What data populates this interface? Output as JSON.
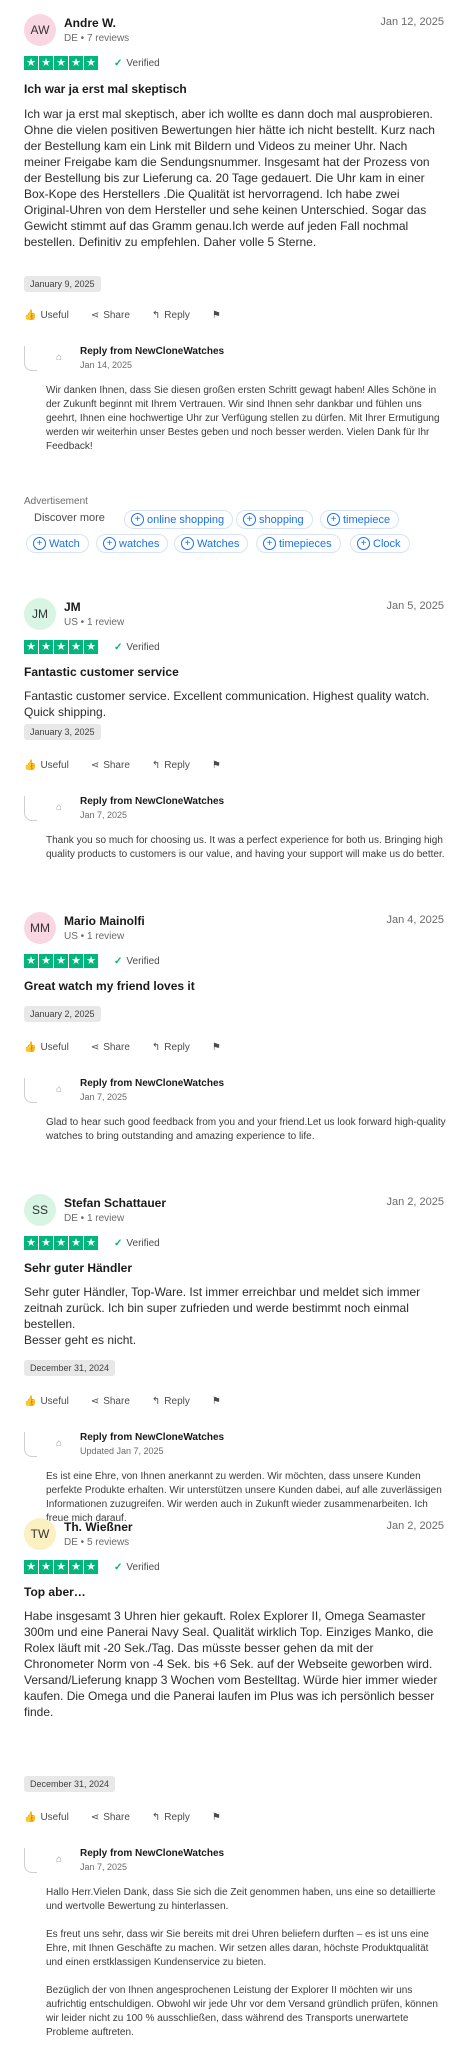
{
  "reviews": [
    {
      "initials": "AW",
      "avatar_color": "#f9d7e2",
      "name": "Andre W.",
      "meta": "DE • 7 reviews",
      "date": "Jan 12, 2025",
      "verified": "Verified",
      "title": "Ich war ja erst mal skeptisch",
      "body": "Ich war ja erst mal skeptisch, aber ich wollte es dann doch mal ausprobieren. Ohne die vielen positiven Bewertungen hier hätte ich nicht bestellt. Kurz nach der Bestellung kam ein Link mit Bildern und Videos zu meiner Uhr. Nach meiner Freigabe kam die Sendungsnummer. Insgesamt hat der Prozess von der Bestellung bis zur Lieferung ca. 20 Tage gedauert. Die Uhr kam in einer Box-Kope des Herstellers .Die Qualität ist hervorragend. Ich habe zwei Original-Uhren von dem Hersteller und sehe keinen Unterschied. Sogar das Gewicht stimmt auf das Gramm genau.Ich werde auf jeden Fall nochmal bestellen. Definitiv zu empfehlen. Daher volle 5 Sterne.",
      "experience_date": "January 9, 2025",
      "reply": {
        "from": "Reply from NewCloneWatches",
        "date": "Jan 14, 2025",
        "text": "Wir danken Ihnen, dass Sie diesen großen ersten Schritt gewagt haben! Alles Schöne in der Zukunft beginnt mit Ihrem Vertrauen. Wir sind Ihnen sehr dankbar und fühlen uns geehrt, Ihnen eine hochwertige Uhr zur Verfügung stellen zu dürfen. Mit Ihrer Ermutigung werden wir weiterhin unser Bestes geben und noch besser werden. Vielen Dank für Ihr Feedback!"
      }
    },
    {
      "initials": "JM",
      "avatar_color": "#d8f5e3",
      "name": "JM",
      "meta": "US • 1 review",
      "date": "Jan 5, 2025",
      "verified": "Verified",
      "title": "Fantastic customer service",
      "body": "Fantastic customer service. Excellent communication. Highest quality watch. Quick shipping.",
      "experience_date": "January 3, 2025",
      "reply": {
        "from": "Reply from NewCloneWatches",
        "date": "Jan 7, 2025",
        "text": "Thank you so much for choosing us. It was a perfect experience for both us. Bringing high quality products to customers is our value, and having your support will make us do better."
      }
    },
    {
      "initials": "MM",
      "avatar_color": "#f9d7e2",
      "name": "Mario Mainolfi",
      "meta": "US • 1 review",
      "date": "Jan 4, 2025",
      "verified": "Verified",
      "title": "Great watch my friend loves it",
      "body": "",
      "experience_date": "January 2, 2025",
      "reply": {
        "from": "Reply from NewCloneWatches",
        "date": "Jan 7, 2025",
        "text": "Glad to hear such good feedback from you and your friend.Let us look forward high-quality watches to bring outstanding and amazing experience to life."
      }
    },
    {
      "initials": "SS",
      "avatar_color": "#d8f5e3",
      "name": "Stefan Schattauer",
      "meta": "DE • 1 review",
      "date": "Jan 2, 2025",
      "verified": "Verified",
      "title": "Sehr guter Händler",
      "body": "Sehr guter Händler, Top-Ware. Ist immer erreichbar und meldet sich immer zeitnah zurück. Ich bin super zufrieden und werde bestimmt noch einmal bestellen.\nBesser geht es nicht.",
      "experience_date": "December 31, 2024",
      "reply": {
        "from": "Reply from NewCloneWatches",
        "date": "Updated Jan 7, 2025",
        "text": "Es ist eine Ehre, von Ihnen anerkannt zu werden. Wir möchten, dass unsere Kunden perfekte Produkte erhalten. Wir unterstützen unsere Kunden dabei, auf alle zuverlässigen Informationen zuzugreifen. Wir werden auch in Zukunft wieder zusammenarbeiten. Ich freue mich darauf."
      }
    },
    {
      "initials": "TW",
      "avatar_color": "#fbf0c2",
      "name": "Th. Wießner",
      "meta": "DE • 5 reviews",
      "date": "Jan 2, 2025",
      "verified": "Verified",
      "title": "Top aber…",
      "body": "Habe insgesamt 3 Uhren hier gekauft. Rolex Explorer II, Omega Seamaster 300m und eine Panerai Navy Seal. Qualität wirklich Top. Einziges Manko, die Rolex läuft mit -20 Sek./Tag. Das müsste besser gehen da mit der Chronometer Norm von -4 Sek. bis +6 Sek. auf der Webseite geworben wird. Versand/Lieferung knapp 3 Wochen vom Bestelltag. Würde hier immer wieder kaufen. Die Omega und die Panerai laufen im Plus was ich persönlich besser finde.",
      "experience_date": "December 31, 2024",
      "reply": {
        "from": "Reply from NewCloneWatches",
        "date": "Jan 7, 2025",
        "text": "Hallo Herr.Vielen Dank, dass Sie sich die Zeit genommen haben, uns eine so detaillierte und wertvolle Bewertung zu hinterlassen.\n\nEs freut uns sehr, dass wir Sie bereits mit drei Uhren beliefern durften – es ist uns eine Ehre, mit Ihnen Geschäfte zu machen. Wir setzen alles daran, höchste Produktqualität und einen erstklassigen Kundenservice zu bieten.\n\nBezüglich der von Ihnen angesprochenen Leistung der Explorer II möchten wir uns aufrichtig entschuldigen. Obwohl wir jede Uhr vor dem Versand gründlich prüfen, können wir leider nicht zu 100 % ausschließen, dass während des Transports unerwartete Probleme auftreten."
      }
    }
  ],
  "actions": {
    "useful": "Useful",
    "share": "Share",
    "reply": "Reply"
  },
  "ad": {
    "label": "Advertisement",
    "discover": "Discover more",
    "chips": [
      "online shopping",
      "shopping",
      "timepiece",
      "Watch",
      "watches",
      "Watches",
      "timepieces",
      "Clock"
    ]
  },
  "colors": {
    "star_green": "#00b67a",
    "chip_blue": "#1a73e8"
  }
}
